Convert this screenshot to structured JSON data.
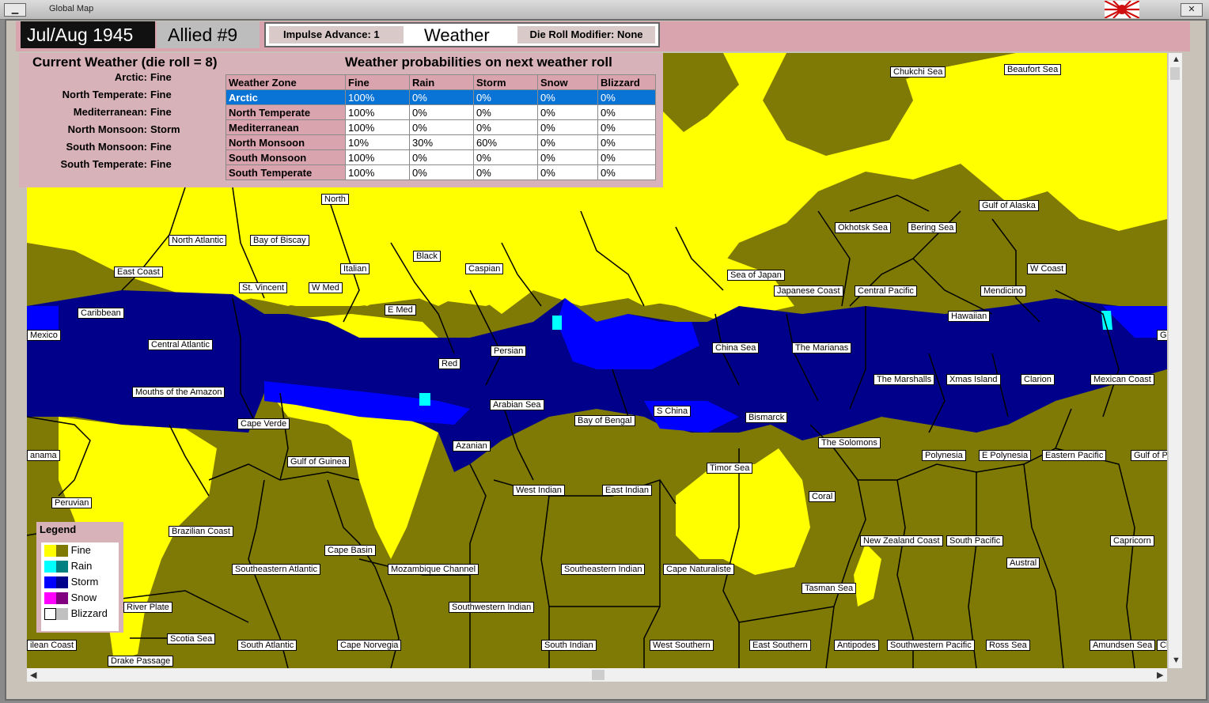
{
  "window": {
    "title": "Global Map",
    "minimize_label": "▁",
    "close_label": "✕"
  },
  "header": {
    "date": "Jul/Aug 1945",
    "turn": "Allied #9",
    "impulse_advance": "Impulse Advance:  1",
    "section_title": "Weather",
    "die_roll_modifier": "Die Roll Modifier:  None"
  },
  "current_weather": {
    "title": "Current Weather (die roll = 8)",
    "rows": [
      {
        "zone": "Arctic:",
        "value": "Fine"
      },
      {
        "zone": "North Temperate:",
        "value": "Fine"
      },
      {
        "zone": "Mediterranean:",
        "value": "Fine"
      },
      {
        "zone": "North Monsoon:",
        "value": "Storm"
      },
      {
        "zone": "South Monsoon:",
        "value": "Fine"
      },
      {
        "zone": "South Temperate:",
        "value": "Fine"
      }
    ]
  },
  "probabilities": {
    "title": "Weather probabilities on next weather roll",
    "headers": [
      "Weather Zone",
      "Fine",
      "Rain",
      "Storm",
      "Snow",
      "Blizzard"
    ],
    "rows": [
      [
        "Arctic",
        "100%",
        "0%",
        "0%",
        "0%",
        "0%"
      ],
      [
        "North Temperate",
        "100%",
        "0%",
        "0%",
        "0%",
        "0%"
      ],
      [
        "Mediterranean",
        "100%",
        "0%",
        "0%",
        "0%",
        "0%"
      ],
      [
        "North Monsoon",
        "10%",
        "30%",
        "60%",
        "0%",
        "0%"
      ],
      [
        "South Monsoon",
        "100%",
        "0%",
        "0%",
        "0%",
        "0%"
      ],
      [
        "South Temperate",
        "100%",
        "0%",
        "0%",
        "0%",
        "0%"
      ]
    ]
  },
  "legend": {
    "title": "Legend",
    "items": [
      {
        "label": "Fine",
        "colors": [
          "#ffff00",
          "#7f7a05"
        ]
      },
      {
        "label": "Rain",
        "colors": [
          "#00ffff",
          "#008080"
        ]
      },
      {
        "label": "Storm",
        "colors": [
          "#0000ff",
          "#00008b"
        ]
      },
      {
        "label": "Snow",
        "colors": [
          "#ff00ff",
          "#800080"
        ]
      },
      {
        "label": "Blizzard",
        "colors": [
          "#ffffff",
          "#c0c0c0"
        ]
      }
    ]
  },
  "sea_areas": [
    "Chukchi Sea",
    "Beaufort Sea",
    "Gulf of Alaska",
    "Okhotsk Sea",
    "Bering Sea",
    "North",
    "North Atlantic",
    "Bay of Biscay",
    "East Coast",
    "Black",
    "Italian",
    "Caspian",
    "W Coast",
    "Sea of Japan",
    "St. Vincent",
    "W Med",
    "Japanese Coast",
    "Central Pacific",
    "Mendicino",
    "E Med",
    "Caribbean",
    "Hawaiian",
    "Mexico",
    "Central Atlantic",
    "Persian",
    "China Sea",
    "The Marianas",
    "G",
    "Red",
    "Mouths of the Amazon",
    "The Marshalls",
    "Xmas Island",
    "Clarion",
    "Mexican Coast",
    "Arabian Sea",
    "S China",
    "Bismarck",
    "Cape Verde",
    "Bay of Bengal",
    "The Solomons",
    "Azanian",
    "anama",
    "Polynesia",
    "E Polynesia",
    "Eastern Pacific",
    "Gulf of P",
    "Gulf of Guinea",
    "Timor Sea",
    "West Indian",
    "East Indian",
    "Coral",
    "Peruvian",
    "Brazilian Coast",
    "New Zealand Coast",
    "South Pacific",
    "Capricorn",
    "Cape Basin",
    "Austral",
    "Southeastern Atlantic",
    "Mozambique Channel",
    "Southeastern Indian",
    "Cape Naturaliste",
    "Tasman Sea",
    "Southwestern Indian",
    "River Plate",
    "Scotia Sea",
    "South Atlantic",
    "Cape Norvegia",
    "South Indian",
    "West Southern",
    "East Southern",
    "Antipodes",
    "Southwestern Pacific",
    "Ross Sea",
    "Amundsen Sea",
    "Ch",
    "ilean Coast",
    "Drake Passage"
  ]
}
